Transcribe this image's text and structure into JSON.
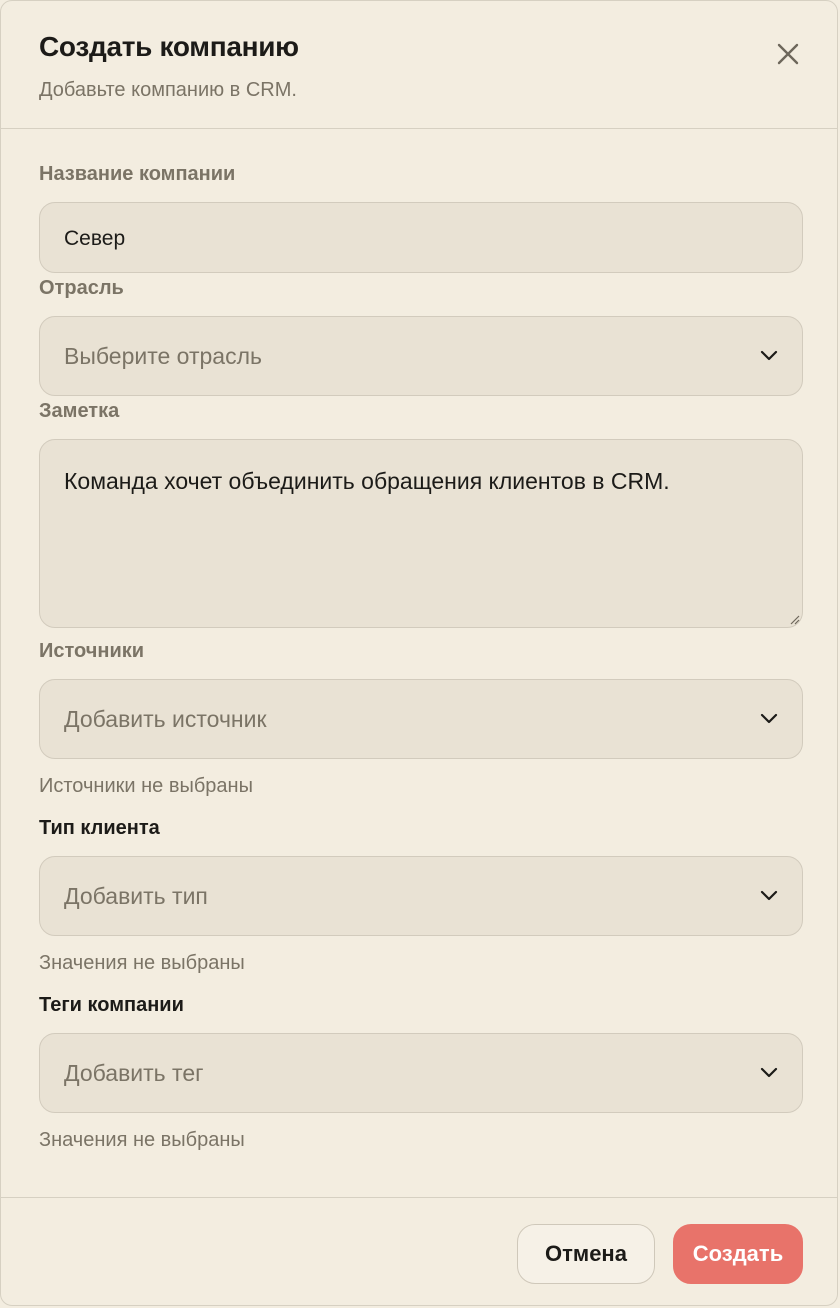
{
  "dialog": {
    "title": "Создать компанию",
    "subtitle": "Добавьте компанию в CRM.",
    "close_icon": "close-icon"
  },
  "form": {
    "company_name": {
      "label": "Название компании",
      "value": "Север"
    },
    "industry": {
      "label": "Отрасль",
      "placeholder": "Выберите отрасль"
    },
    "note": {
      "label": "Заметка",
      "value": "Команда хочет объединить обращения клиентов в CRM."
    },
    "sources": {
      "label": "Источники",
      "placeholder": "Добавить источник",
      "helper": "Источники не выбраны"
    },
    "client_type": {
      "label": "Тип клиента",
      "placeholder": "Добавить тип",
      "helper": "Значения не выбраны"
    },
    "tags": {
      "label": "Теги компании",
      "placeholder": "Добавить тег",
      "helper": "Значения не выбраны"
    }
  },
  "footer": {
    "cancel_label": "Отмена",
    "create_label": "Создать"
  },
  "colors": {
    "background": "#f3ede0",
    "field": "#e9e2d4",
    "accent": "#e8736a",
    "muted_text": "#7b7466"
  }
}
